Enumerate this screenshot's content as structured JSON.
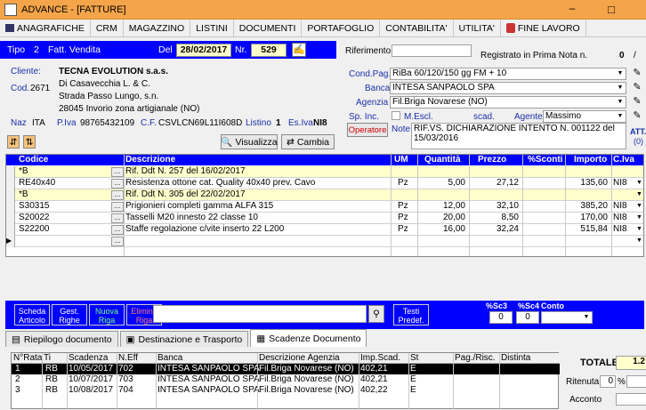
{
  "window": {
    "title": "ADVANCE - [FATTURE]"
  },
  "menu": [
    {
      "label": "ANAGRAFICHE",
      "icon": "grid-icon"
    },
    {
      "label": "CRM"
    },
    {
      "label": "MAGAZZINO"
    },
    {
      "label": "LISTINI"
    },
    {
      "label": "DOCUMENTI"
    },
    {
      "label": "PORTAFOGLIO"
    },
    {
      "label": "CONTABILITA'"
    },
    {
      "label": "UTILITA'"
    },
    {
      "label": "FINE LAVORO",
      "icon": "exit-icon"
    }
  ],
  "doc": {
    "tipo_label": "Tipo",
    "tipo": "2",
    "tipo_desc": "Fatt. Vendita",
    "del_label": "Del",
    "date": "28/02/2017",
    "nr_label": "Nr.",
    "number": "529"
  },
  "riferimento": {
    "label": "Riferimento",
    "value": ""
  },
  "registrato": {
    "label": "Registrato in Prima Nota n.",
    "value": "0",
    "slash": "/"
  },
  "customer": {
    "label": "Cliente:",
    "name": "TECNA EVOLUTION s.a.s.",
    "cod_label": "Cod.",
    "cod": "2671",
    "line1": "Di Casavecchia L. & C.",
    "line2": "Strada Passo Lungo, s.n.",
    "line3": "28045 Invorio  zona artigianale (NO)",
    "naz_label": "Naz",
    "naz": "ITA",
    "piva_label": "P.Iva",
    "piva": "98765432109",
    "cf_label": "C.F.",
    "cf": "CSVLCN69L11I608D",
    "listino_label": "Listino",
    "listino": "1",
    "esiva_label": "Es.Iva",
    "esiva": "NI8"
  },
  "conditions": {
    "condpag_label": "Cond.Pag.",
    "condpag": "RiBa 60/120/150 gg FM + 10",
    "banca_label": "Banca",
    "banca": "INTESA SANPAOLO SPA",
    "agenzia_label": "Agenzia",
    "agenzia": "Fil.Briga Novarese (NO)",
    "spinc_label": "Sp. Inc.",
    "mescl_label": "M.Escl.",
    "scad_label": "scad.",
    "agente_label": "Agente",
    "agente": "Massimo",
    "operatore_label": "Operatore",
    "note_label": "Note",
    "note": "RIF.VS. DICHIARAZIONE INTENTO N. 001122 del 15/03/2016",
    "att_label": "ATT.",
    "att_count": "(0)"
  },
  "buttons": {
    "visualizza": "Visualizza",
    "cambia": "Cambia"
  },
  "grid": {
    "headers": [
      "Codice",
      "Descrizione",
      "UM",
      "Quantità",
      "Prezzo",
      "%Sconti",
      "Importo",
      "C.Iva"
    ],
    "rows": [
      {
        "codice": "*B",
        "descrizione": "Rif. Ddt N. 257 del 16/02/2017",
        "um": "",
        "qta": "",
        "prezzo": "",
        "sconti": "",
        "importo": "",
        "civa": "",
        "yellow": true
      },
      {
        "codice": "RE40x40",
        "descrizione": "Resistenza ottone cat. Quality 40x40 prev. Cavo",
        "um": "Pz",
        "qta": "5,00",
        "prezzo": "27,12",
        "sconti": "",
        "importo": "135,60",
        "civa": "NI8",
        "yellow": false
      },
      {
        "codice": "*B",
        "descrizione": "Rif. Ddt N. 305 del 22/02/2017",
        "um": "",
        "qta": "",
        "prezzo": "",
        "sconti": "",
        "importo": "",
        "civa": "",
        "yellow": true
      },
      {
        "codice": "S30315",
        "descrizione": "Prigionieri completi gamma ALFA 315",
        "um": "Pz",
        "qta": "12,00",
        "prezzo": "32,10",
        "sconti": "",
        "importo": "385,20",
        "civa": "NI8",
        "yellow": false
      },
      {
        "codice": "S20022",
        "descrizione": "Tasselli M20 innesto 22 classe 10",
        "um": "Pz",
        "qta": "20,00",
        "prezzo": "8,50",
        "sconti": "",
        "importo": "170,00",
        "civa": "NI8",
        "yellow": false
      },
      {
        "codice": "S22200",
        "descrizione": "Staffe regolazione c/vite inserto 22 L200",
        "um": "Pz",
        "qta": "16,00",
        "prezzo": "32,24",
        "sconti": "",
        "importo": "515,84",
        "civa": "NI8",
        "yellow": false
      },
      {
        "codice": "",
        "descrizione": "",
        "um": "",
        "qta": "",
        "prezzo": "",
        "sconti": "",
        "importo": "",
        "civa": "",
        "yellow": false
      }
    ]
  },
  "bottombar": {
    "scheda": [
      "Scheda",
      "Articolo"
    ],
    "gest": [
      "Gest.",
      "Righe"
    ],
    "nuova": [
      "Nuova",
      "Riga"
    ],
    "elimina": [
      "Elimina",
      "Riga"
    ],
    "testi": [
      "Testi",
      "Predef."
    ],
    "sc3_label": "%Sc3",
    "sc3": "0",
    "sc4_label": "%Sc4",
    "sc4": "0",
    "conto_label": "Conto"
  },
  "tabs": [
    {
      "label": "Riepilogo documento"
    },
    {
      "label": "Destinazione e Trasporto"
    },
    {
      "label": "Scadenze Documento"
    }
  ],
  "scadenze": {
    "headers": [
      "N°Rata",
      "Ti",
      "Scadenza",
      "N.Eff",
      "Banca",
      "Descrizione Agenzia",
      "Imp.Scad.",
      "St",
      "Pag./Risc.",
      "Distinta"
    ],
    "rows": [
      {
        "n": "1",
        "ti": "RB",
        "scad": "10/05/2017",
        "neff": "702",
        "banca": "INTESA SANPAOLO SPA",
        "agenzia": "Fil.Briga Novarese (NO)",
        "imp": "402,21",
        "st": "E"
      },
      {
        "n": "2",
        "ti": "RB",
        "scad": "10/07/2017",
        "neff": "703",
        "banca": "INTESA SANPAOLO SPA",
        "agenzia": "Fil.Briga Novarese (NO)",
        "imp": "402,21",
        "st": "E"
      },
      {
        "n": "3",
        "ti": "RB",
        "scad": "10/08/2017",
        "neff": "704",
        "banca": "INTESA SANPAOLO SPA",
        "agenzia": "Fil.Briga Novarese (NO)",
        "imp": "402,22",
        "st": "E"
      }
    ]
  },
  "totals": {
    "totale_label": "TOTALE",
    "totale": "1.2",
    "ritenuta_label": "Ritenuta",
    "ritenuta": "0",
    "pct": "%",
    "acconto_label": "Acconto"
  }
}
